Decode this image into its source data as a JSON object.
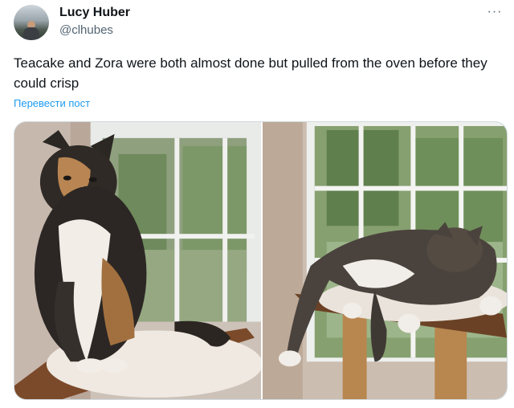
{
  "author": {
    "name": "Lucy Huber",
    "handle": "@clhubes"
  },
  "more_label": "···",
  "post_text": "Teacake and Zora were both almost done but pulled from the oven before they could crisp",
  "translate_label": "Перевести пост",
  "colors": {
    "link": "#1d9bf0",
    "text": "#0f1419",
    "secondary": "#536471"
  },
  "icons": {
    "more": "more-horizontal-icon"
  }
}
